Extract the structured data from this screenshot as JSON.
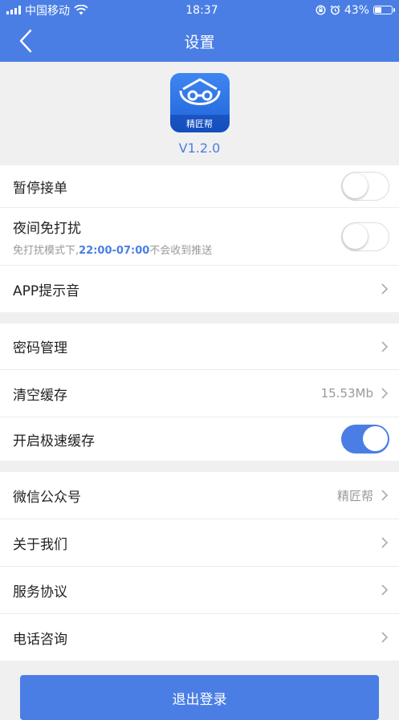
{
  "status_bar": {
    "carrier": "中国移动",
    "time": "18:37",
    "battery": "43%",
    "battery_level": 0.43
  },
  "nav": {
    "title": "设置"
  },
  "app": {
    "logo_label": "精匠帮",
    "version": "V1.2.0"
  },
  "group1": {
    "pause_orders": {
      "label": "暂停接单",
      "enabled": false
    },
    "dnd": {
      "label": "夜间免打扰",
      "desc_prefix": "免打扰模式下,",
      "desc_time": "22:00-07:00",
      "desc_suffix": "不会收到推送",
      "enabled": false
    },
    "app_sound": {
      "label": "APP提示音"
    }
  },
  "group2": {
    "password": {
      "label": "密码管理"
    },
    "clear_cache": {
      "label": "清空缓存",
      "value": "15.53Mb"
    },
    "fast_cache": {
      "label": "开启极速缓存",
      "enabled": true
    }
  },
  "group3": {
    "wechat": {
      "label": "微信公众号",
      "value": "精匠帮"
    },
    "about": {
      "label": "关于我们"
    },
    "service": {
      "label": "服务协议"
    },
    "phone": {
      "label": "电话咨询"
    }
  },
  "logout": {
    "label": "退出登录"
  },
  "colors": {
    "primary": "#4a7ee5",
    "background": "#f0f0f0"
  }
}
